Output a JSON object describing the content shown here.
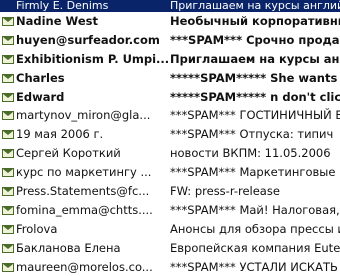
{
  "messages": [
    {
      "sender": "Firmly E. Denims",
      "subject": "Приглашаем на курсы английского",
      "selected": true,
      "bold": false
    },
    {
      "sender": "Nadine West",
      "subject": "Необычный корпоративный о",
      "selected": false,
      "bold": true
    },
    {
      "sender": "huyen@surfeador.com",
      "subject": "***SPAM*** Срочно продает",
      "selected": false,
      "bold": true
    },
    {
      "sender": "Exhibitionism P. Umpi...",
      "subject": "Приглашаем на курсы англи",
      "selected": false,
      "bold": true
    },
    {
      "sender": "Charles",
      "subject": "*****SPAM***** She wants a",
      "selected": false,
      "bold": true
    },
    {
      "sender": "Edward",
      "subject": "*****SPAM***** n don't click",
      "selected": false,
      "bold": true
    },
    {
      "sender": "martynov_miron@gla...",
      "subject": "***SPAM*** ГОСТИНИЧНЫЙ Б",
      "selected": false,
      "bold": false
    },
    {
      "sender": "19 мая 2006 г.",
      "subject": "***SPAM*** Отпуска: типич",
      "selected": false,
      "bold": false
    },
    {
      "sender": "Сергей Короткий",
      "subject": "новости ВКПМ: 11.05.2006",
      "selected": false,
      "bold": false
    },
    {
      "sender": "курс по маркетингу ...",
      "subject": "***SPAM*** Маркетинговые",
      "selected": false,
      "bold": false
    },
    {
      "sender": "Press.Statements@fc...",
      "subject": "FW: press-r-release",
      "selected": false,
      "bold": false
    },
    {
      "sender": "fomina_emma@chtts....",
      "subject": "***SPAM*** Май! Налоговая,",
      "selected": false,
      "bold": false
    },
    {
      "sender": "Frolova",
      "subject": "Анонсы для обзора прессы и",
      "selected": false,
      "bold": false
    },
    {
      "sender": "Бакланова Елена",
      "subject": "Европейская компания Eutex",
      "selected": false,
      "bold": false
    },
    {
      "sender": "maureen@morelos.co...",
      "subject": "***SPAM*** УСТАЛИ ИСКАТЬ",
      "selected": false,
      "bold": false
    }
  ]
}
